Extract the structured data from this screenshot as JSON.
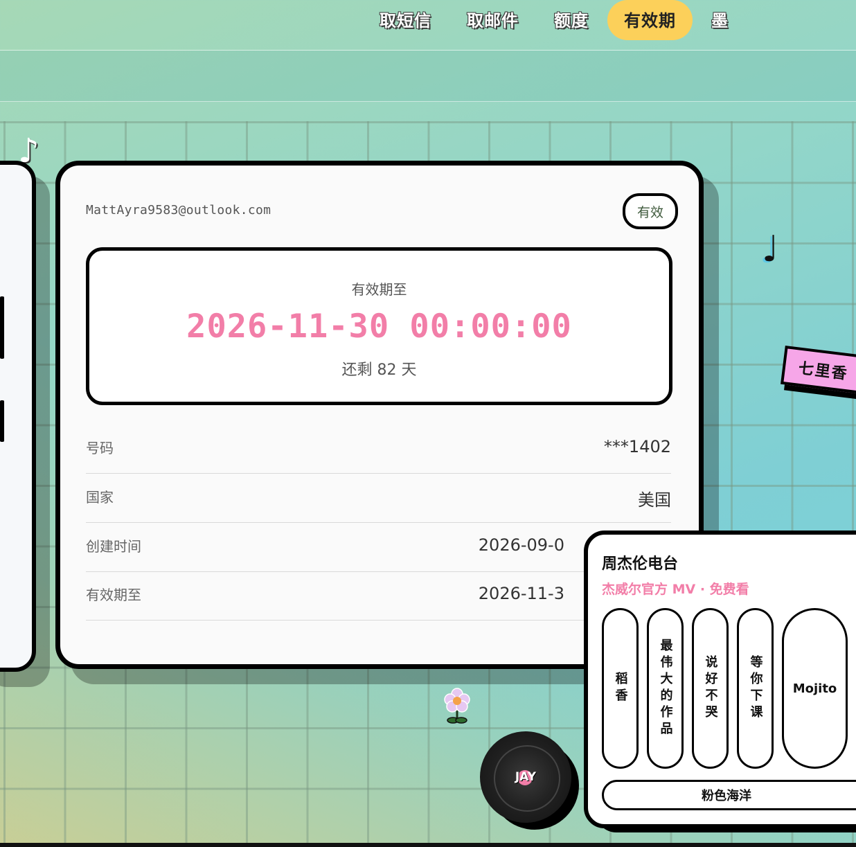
{
  "nav": {
    "items": [
      {
        "label": "取短信",
        "active": false
      },
      {
        "label": "取邮件",
        "active": false
      },
      {
        "label": "额度",
        "active": false
      },
      {
        "label": "有效期",
        "active": true
      },
      {
        "label": "墨",
        "active": false
      }
    ]
  },
  "card": {
    "email": "MattAyra9583@outlook.com",
    "status_badge": "有效",
    "expiry": {
      "label": "有效期至",
      "datetime": "2026-11-30 00:00:00",
      "remaining": "还剩 82 天"
    },
    "rows": [
      {
        "label": "号码",
        "value": "***1402"
      },
      {
        "label": "国家",
        "value": "美国"
      },
      {
        "label": "创建时间",
        "value": "2026-09-0"
      },
      {
        "label": "有效期至",
        "value": "2026-11-3"
      }
    ]
  },
  "decor": {
    "note_1": "♪",
    "note_2": "♩",
    "sticker": "七里香",
    "vinyl_label": "JAY"
  },
  "radio": {
    "title": "周杰伦电台",
    "subtitle": "杰威尔官方 MV · 免费看",
    "songs": [
      "稻香",
      "最伟大的作品",
      "说好不哭",
      "等你下课",
      "Mojito"
    ],
    "bottom_song": "粉色海洋"
  },
  "colors": {
    "accent_pink": "#f27ea8",
    "active_tab": "#fcd05a",
    "sticker_pink": "#f6a6e8"
  }
}
